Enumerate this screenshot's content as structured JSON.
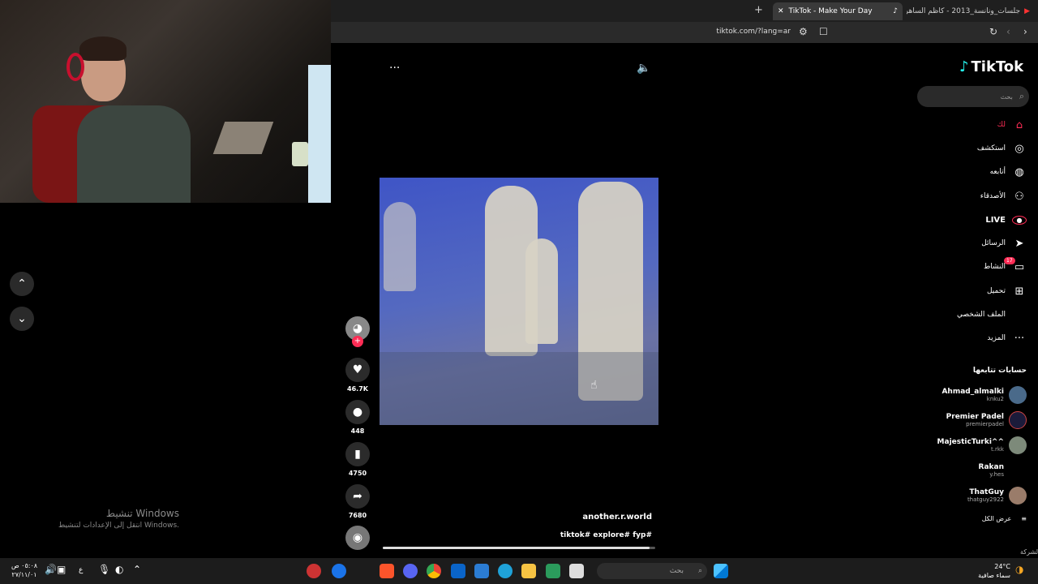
{
  "browser": {
    "tabs": [
      {
        "title": "TikTok - Make Your Day",
        "active": true
      },
      {
        "title": "#جلسات_ونانسة_2013 - كاظم الساهر",
        "active": false
      }
    ],
    "url": "tiktok.com/?lang=ar"
  },
  "video": {
    "more_label": "···",
    "username": "another.r.world",
    "caption": "tiktok# explore# fyp#",
    "progress": 0.98
  },
  "actions": {
    "likes": "46.7K",
    "comments": "448",
    "saves": "4750",
    "shares": "7680"
  },
  "sidebar": {
    "logo": "TikTok",
    "search_placeholder": "بحث",
    "nav": [
      {
        "label": "لك",
        "icon": "home-icon",
        "active": true
      },
      {
        "label": "استكشف",
        "icon": "compass-icon"
      },
      {
        "label": "أتابعه",
        "icon": "avatar-icon"
      },
      {
        "label": "الأصدقاء",
        "icon": "friends-icon"
      },
      {
        "label": "LIVE",
        "icon": "live-icon"
      },
      {
        "label": "الرسائل",
        "icon": "send-icon"
      },
      {
        "label": "النشاط",
        "icon": "inbox-icon",
        "badge": "17"
      },
      {
        "label": "تحميل",
        "icon": "upload-icon"
      },
      {
        "label": "الملف الشخصي",
        "icon": "profile-icon"
      },
      {
        "label": "المزيد",
        "icon": "more-icon"
      }
    ],
    "following_title": "حسابات تتابعها",
    "following": [
      {
        "display": "Ahmad_almalki",
        "user": "knku2"
      },
      {
        "display": "Premier Padel",
        "user": "premierpadel"
      },
      {
        "display": "MajesticTurki^^",
        "user": "t.rkk"
      },
      {
        "display": "Rakan",
        "user": "y.hes"
      },
      {
        "display": "ThatGuy",
        "user": "thatguy2922"
      }
    ],
    "see_all": "عرض الكل",
    "footer_partial": "الشركة"
  },
  "watermark": {
    "title": "تنشيط Windows",
    "subtitle": "انتقل إلى الإعدادات لتنشيط Windows."
  },
  "taskbar": {
    "search": "بحث",
    "weather_temp": "24°C",
    "weather_text": "سماء صافية",
    "time": "٠٥:٠٨ ص",
    "date": "٢٧/١١/٠١",
    "lang": "ع"
  },
  "colors": {
    "accent": "#fe2c55",
    "cyan": "#25f4ee"
  }
}
